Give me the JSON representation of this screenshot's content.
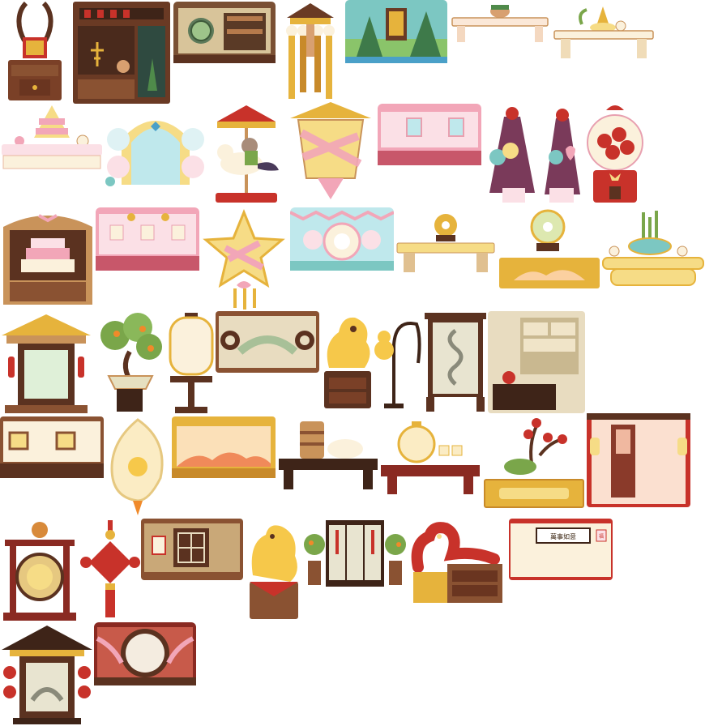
{
  "sheet": {
    "background": "#ffffff",
    "item_count": 47,
    "palette": {
      "wood_dark": "#5b3220",
      "wood_mid": "#8a5232",
      "wood_light": "#c9935a",
      "gold": "#e6b33c",
      "gold_light": "#f6dc86",
      "red": "#c8322a",
      "pink": "#f2a6b8",
      "pink_light": "#fbe0e6",
      "cream": "#fbf1dc",
      "teal": "#7cc7c2",
      "green": "#7aa64a",
      "purple": "#7a3a5a"
    }
  },
  "banners": {
    "screen_text": "萬事如意",
    "seal_text": "福"
  },
  "items": [
    {
      "name": "antler-altar",
      "icon": "antler-cabinet"
    },
    {
      "name": "herbal-shop-wall",
      "icon": "shop-shelves"
    },
    {
      "name": "tea-house-wall",
      "icon": "round-window-wall"
    },
    {
      "name": "pagoda-lantern-tassel",
      "icon": "pagoda-tassel"
    },
    {
      "name": "bamboo-painting-wall",
      "icon": "landscape-panel"
    },
    {
      "name": "offering-table-small",
      "icon": "low-table"
    },
    {
      "name": "tea-set-table",
      "icon": "tea-table"
    },
    {
      "name": "dessert-party-table",
      "icon": "dessert-table"
    },
    {
      "name": "balloon-arch-backdrop",
      "icon": "balloon-arch"
    },
    {
      "name": "carousel-horse",
      "icon": "carousel"
    },
    {
      "name": "ribbon-lantern",
      "icon": "gift-lantern"
    },
    {
      "name": "pink-wall-panel",
      "icon": "pink-wall"
    },
    {
      "name": "balloon-bag-purple",
      "icon": "gift-bag"
    },
    {
      "name": "balloon-bag-heart",
      "icon": "gift-bag-heart"
    },
    {
      "name": "apple-gumball-machine",
      "icon": "gumball"
    },
    {
      "name": "cake-display-cabinet",
      "icon": "cake-cabinet"
    },
    {
      "name": "pink-lantern-wall",
      "icon": "pink-lantern-wall"
    },
    {
      "name": "star-lantern",
      "icon": "star-lantern"
    },
    {
      "name": "kitty-party-wall",
      "icon": "kitty-wall"
    },
    {
      "name": "jade-disc-bench",
      "icon": "jade-disc"
    },
    {
      "name": "jade-disc-stand",
      "icon": "jade-disc-stand"
    },
    {
      "name": "lucky-bamboo-table",
      "icon": "bamboo-pot"
    },
    {
      "name": "gold-pavilion-gate",
      "icon": "pavilion-gate"
    },
    {
      "name": "bonsai-orange-tree",
      "icon": "bonsai"
    },
    {
      "name": "paper-floor-lamp",
      "icon": "floor-lamp"
    },
    {
      "name": "lattice-wall-panel",
      "icon": "lattice-wall"
    },
    {
      "name": "golden-qilin-statue",
      "icon": "qilin"
    },
    {
      "name": "gourd-hook-lamp",
      "icon": "gourd-lamp"
    },
    {
      "name": "dragon-folding-screen",
      "icon": "dragon-screen"
    },
    {
      "name": "curio-shelf-wall",
      "icon": "curio-shelf"
    },
    {
      "name": "gold-trim-wall",
      "icon": "gold-wall"
    },
    {
      "name": "jade-pendant-lamp",
      "icon": "jade-pendant"
    },
    {
      "name": "sunset-mountain-panel",
      "icon": "mountain-panel"
    },
    {
      "name": "dim-sum-steamer-table",
      "icon": "steamer-table"
    },
    {
      "name": "golden-teapot-table",
      "icon": "teapot-table"
    },
    {
      "name": "plum-blossom-bench",
      "icon": "plum-bench"
    },
    {
      "name": "red-lantern-window",
      "icon": "lantern-window"
    },
    {
      "name": "temple-gong-stand",
      "icon": "gong"
    },
    {
      "name": "chinese-knot-ornament",
      "icon": "chinese-knot"
    },
    {
      "name": "lattice-window-wall",
      "icon": "window-wall"
    },
    {
      "name": "golden-dragon-chest",
      "icon": "gold-dragon-chest"
    },
    {
      "name": "orange-tree-screen",
      "icon": "orange-screen"
    },
    {
      "name": "red-dragon-cabinet",
      "icon": "red-dragon"
    },
    {
      "name": "calligraphy-wall",
      "icon": "calligraphy-wall"
    },
    {
      "name": "pagoda-lantern-pavilion",
      "icon": "pagoda"
    },
    {
      "name": "moon-window-wall",
      "icon": "moon-window"
    }
  ]
}
